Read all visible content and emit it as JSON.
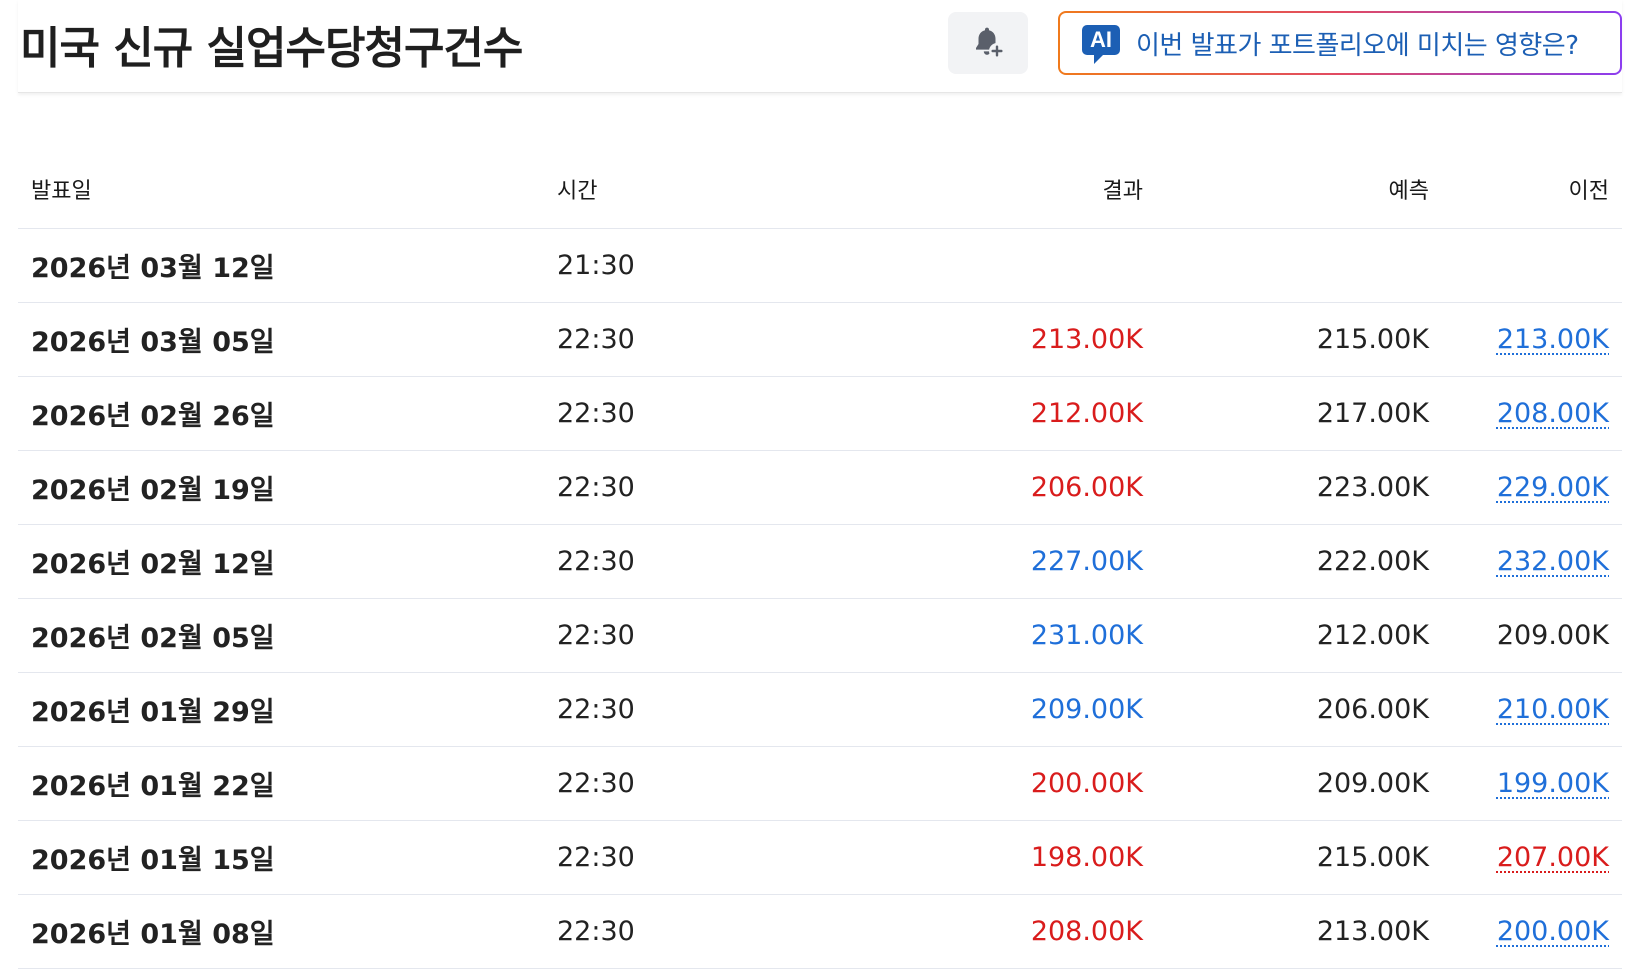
{
  "header": {
    "title": "미국 신규 실업수당청구건수",
    "ai_button_badge": "AI",
    "ai_button_label": "이번 발표가 포트폴리오에 미치는 영향은?"
  },
  "colors": {
    "negative": "#d91c1c",
    "positive": "#1f6fd9",
    "neutral": "#222222",
    "ai_blue": "#1c5fb4"
  },
  "table": {
    "columns": [
      "발표일",
      "시간",
      "결과",
      "예측",
      "이전"
    ],
    "rows": [
      {
        "date": "2026년 03월 12일",
        "time": "21:30",
        "actual": "",
        "actual_color": "dark",
        "forecast": "",
        "previous": "",
        "previous_color": "dark",
        "previous_revised": false
      },
      {
        "date": "2026년 03월 05일",
        "time": "22:30",
        "actual": "213.00K",
        "actual_color": "red",
        "forecast": "215.00K",
        "previous": "213.00K",
        "previous_color": "blue",
        "previous_revised": true
      },
      {
        "date": "2026년 02월 26일",
        "time": "22:30",
        "actual": "212.00K",
        "actual_color": "red",
        "forecast": "217.00K",
        "previous": "208.00K",
        "previous_color": "blue",
        "previous_revised": true
      },
      {
        "date": "2026년 02월 19일",
        "time": "22:30",
        "actual": "206.00K",
        "actual_color": "red",
        "forecast": "223.00K",
        "previous": "229.00K",
        "previous_color": "blue",
        "previous_revised": true
      },
      {
        "date": "2026년 02월 12일",
        "time": "22:30",
        "actual": "227.00K",
        "actual_color": "blue",
        "forecast": "222.00K",
        "previous": "232.00K",
        "previous_color": "blue",
        "previous_revised": true
      },
      {
        "date": "2026년 02월 05일",
        "time": "22:30",
        "actual": "231.00K",
        "actual_color": "blue",
        "forecast": "212.00K",
        "previous": "209.00K",
        "previous_color": "dark",
        "previous_revised": false
      },
      {
        "date": "2026년 01월 29일",
        "time": "22:30",
        "actual": "209.00K",
        "actual_color": "blue",
        "forecast": "206.00K",
        "previous": "210.00K",
        "previous_color": "blue",
        "previous_revised": true
      },
      {
        "date": "2026년 01월 22일",
        "time": "22:30",
        "actual": "200.00K",
        "actual_color": "red",
        "forecast": "209.00K",
        "previous": "199.00K",
        "previous_color": "blue",
        "previous_revised": true
      },
      {
        "date": "2026년 01월 15일",
        "time": "22:30",
        "actual": "198.00K",
        "actual_color": "red",
        "forecast": "215.00K",
        "previous": "207.00K",
        "previous_color": "red",
        "previous_revised": true
      },
      {
        "date": "2026년 01월 08일",
        "time": "22:30",
        "actual": "208.00K",
        "actual_color": "red",
        "forecast": "213.00K",
        "previous": "200.00K",
        "previous_color": "blue",
        "previous_revised": true
      }
    ]
  }
}
